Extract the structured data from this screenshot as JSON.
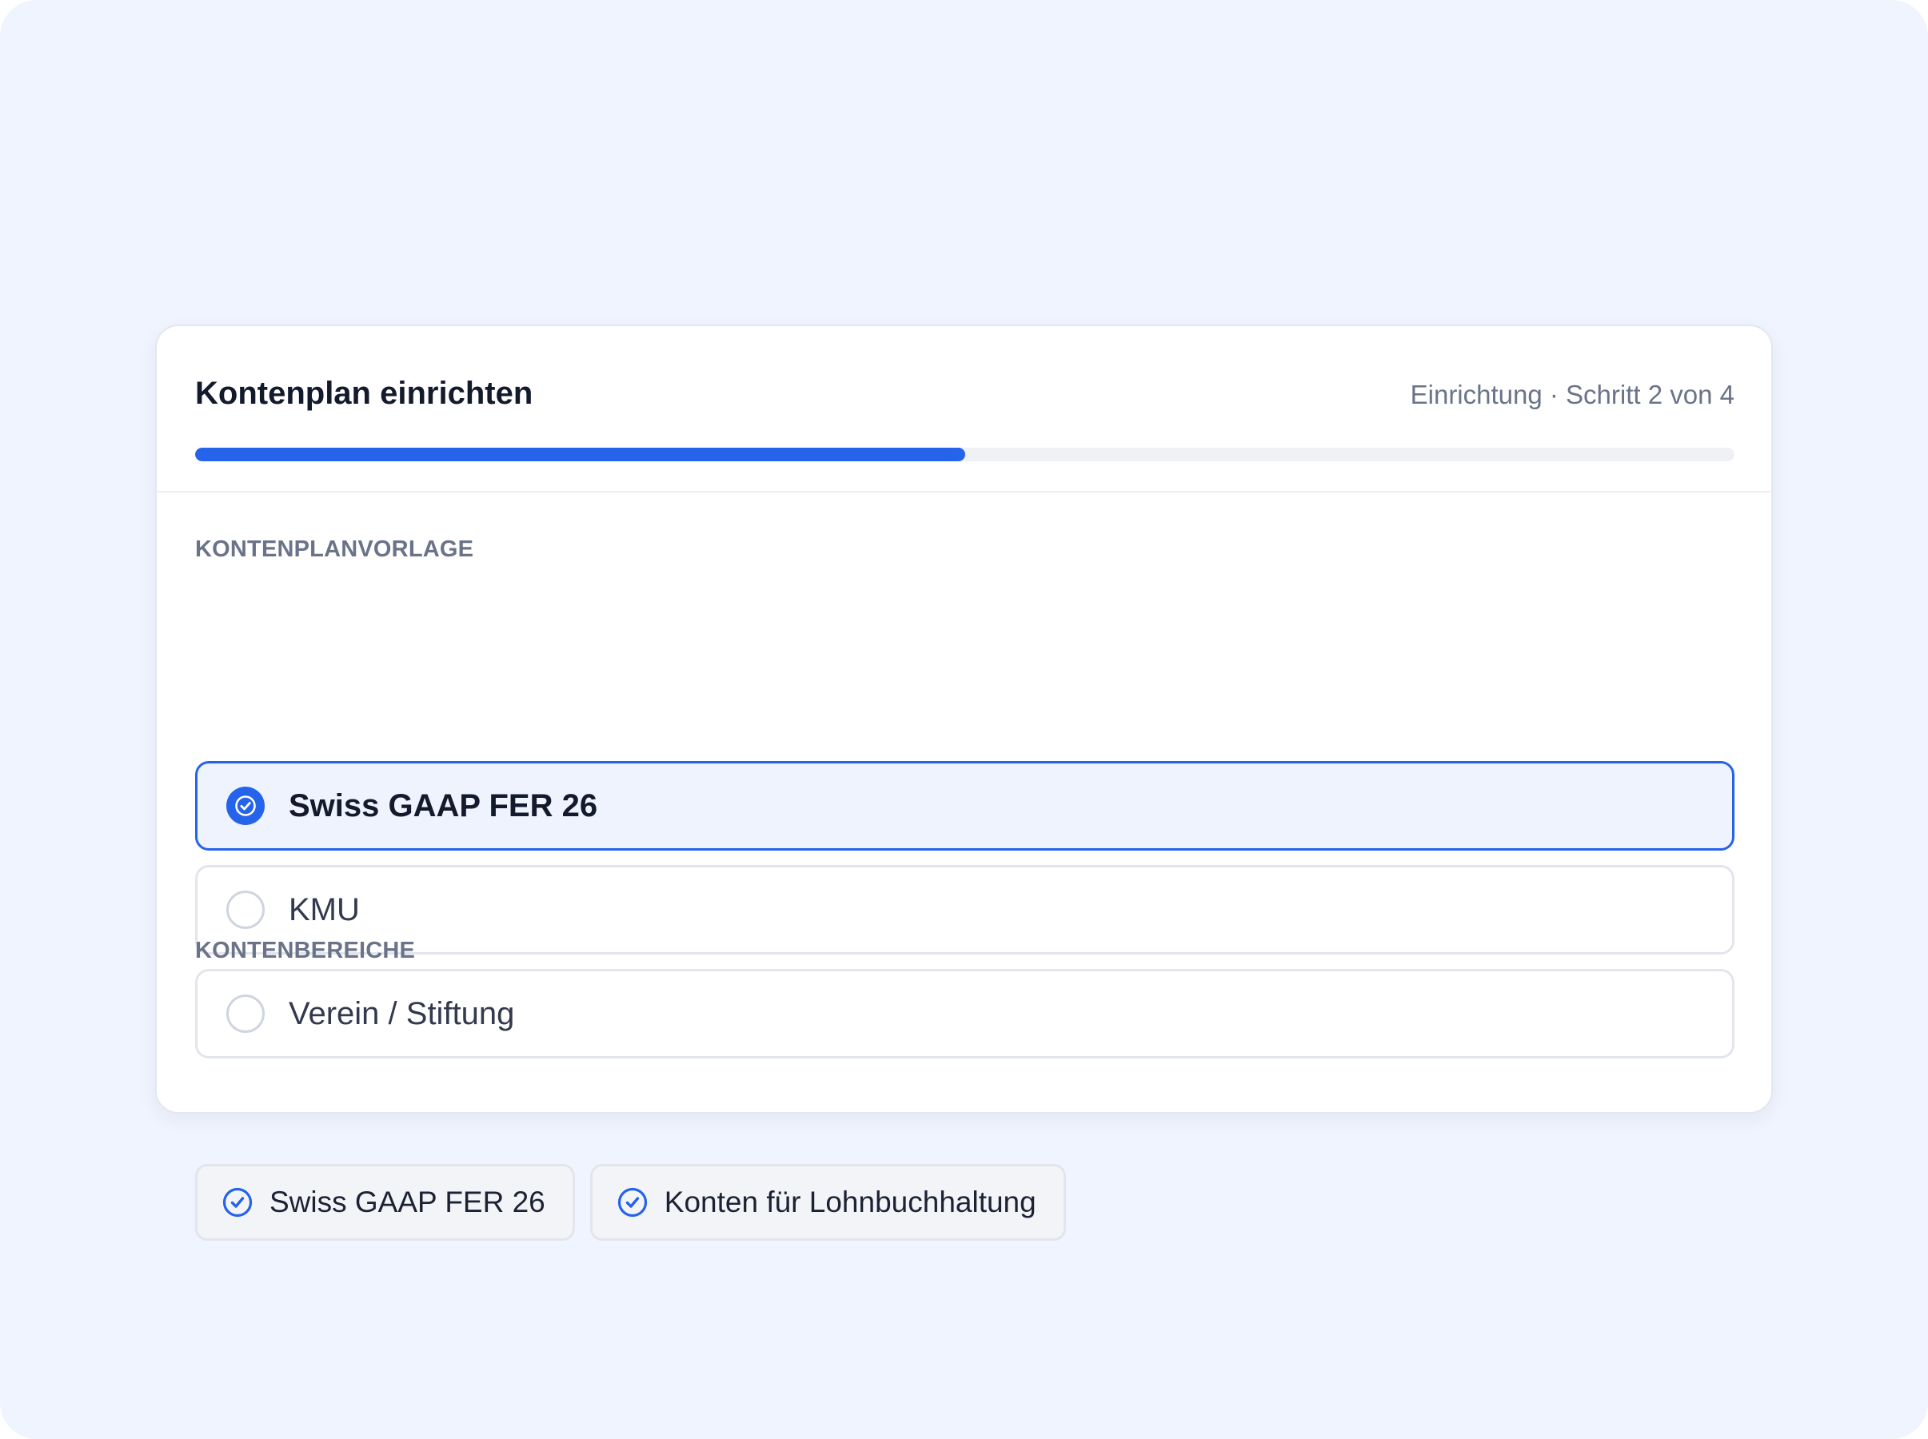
{
  "wizard": {
    "title": "Kontenplan einrichten",
    "step_label": "Einrichtung · Schritt 2 von 4",
    "progress": 0.5
  },
  "template_section": {
    "label": "KONTENPLANVORLAGE",
    "options": [
      {
        "label": "Swiss GAAP FER 26",
        "selected": true
      },
      {
        "label": "KMU",
        "selected": false
      },
      {
        "label": "Verein / Stiftung",
        "selected": false
      }
    ]
  },
  "areas_section": {
    "label": "KONTENBEREICHE",
    "chips": [
      {
        "label": "Swiss GAAP FER 26",
        "checked": true,
        "icon": "check-circle-icon"
      },
      {
        "label": "Konten für Lohnbuchhaltung",
        "checked": true,
        "icon": "check-circle-icon"
      }
    ]
  },
  "colors": {
    "accent": "#2563eb",
    "background": "#eff4fe"
  }
}
